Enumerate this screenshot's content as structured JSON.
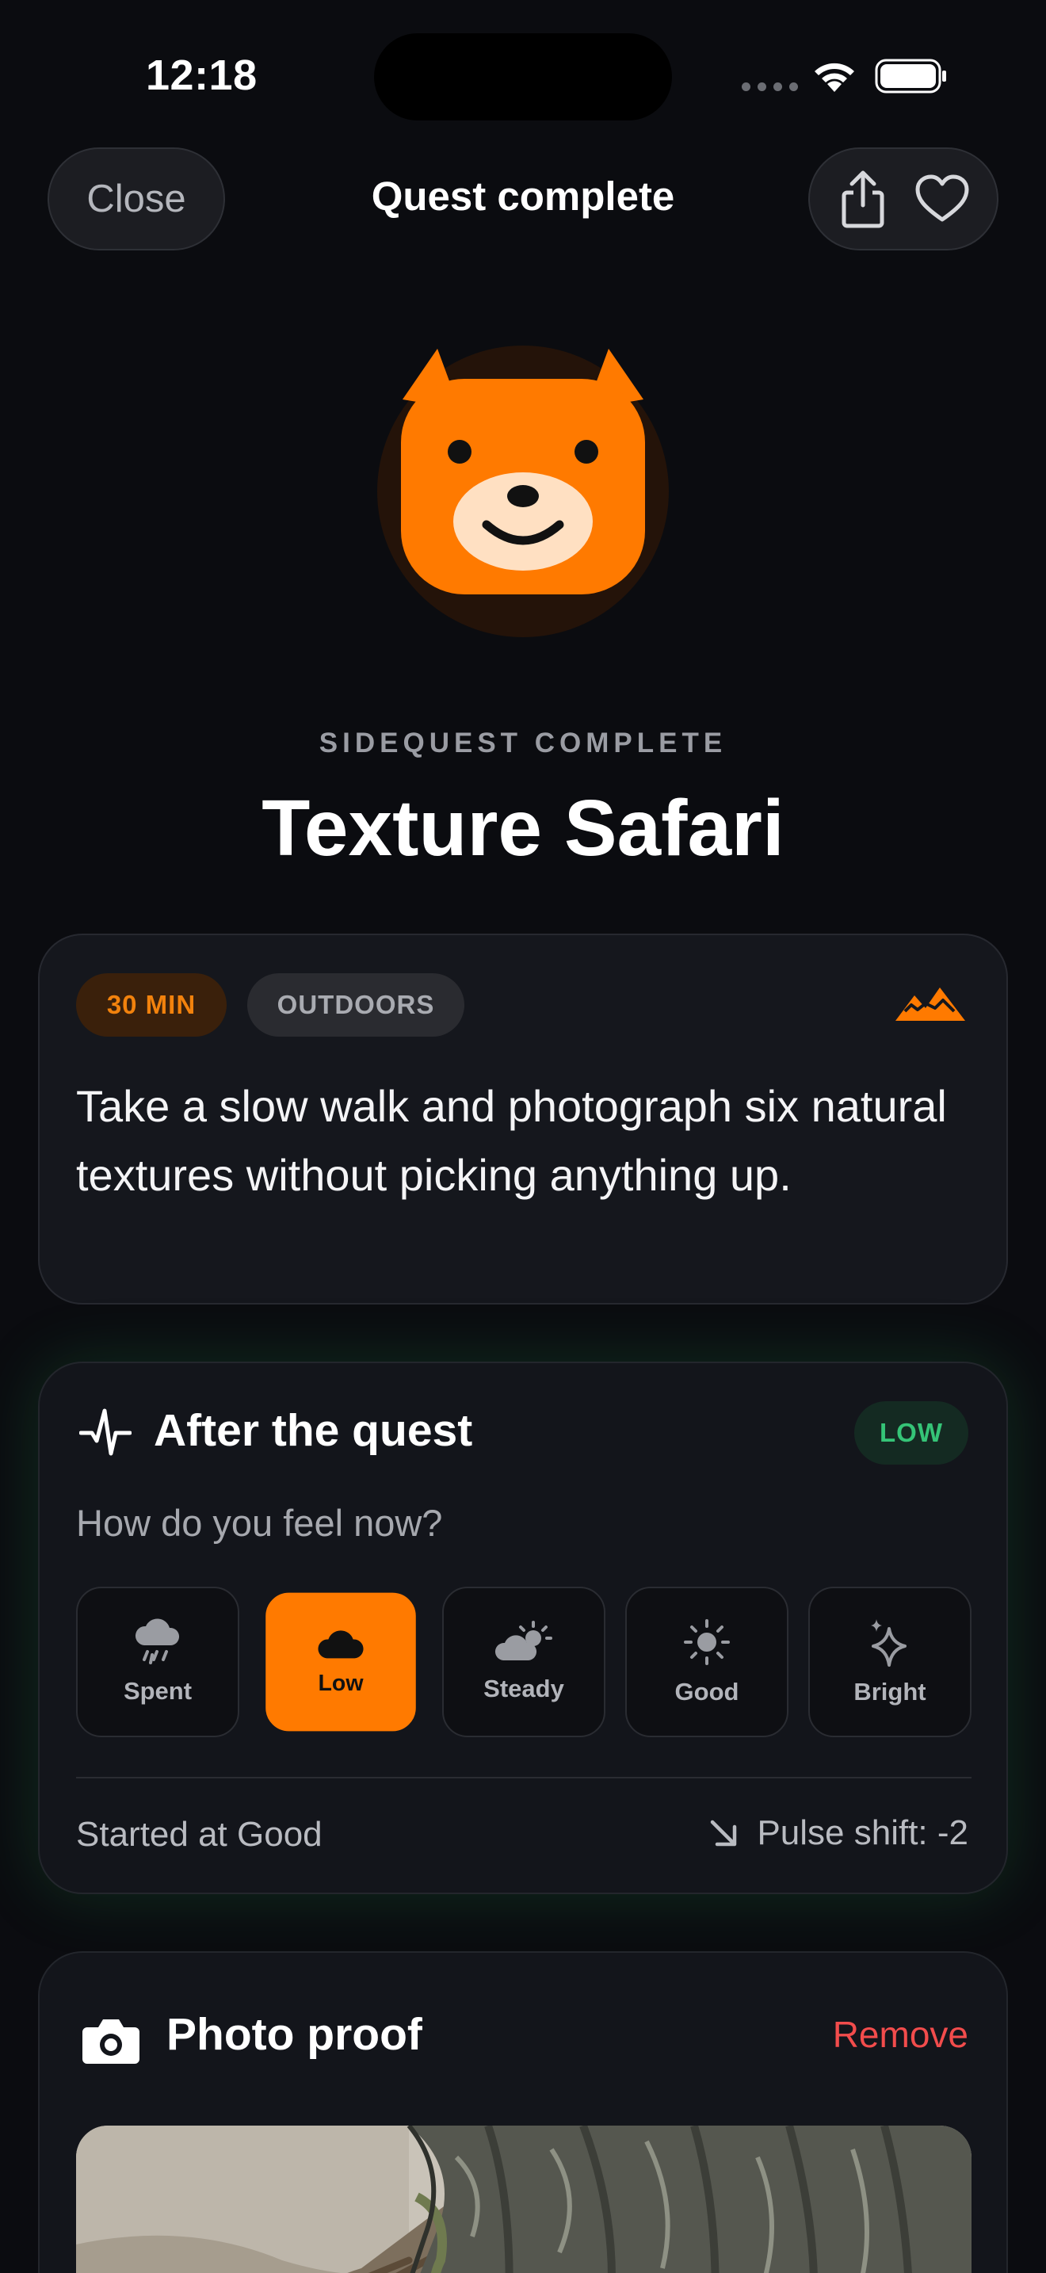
{
  "status": {
    "time": "12:18"
  },
  "nav": {
    "close_label": "Close",
    "title": "Quest complete"
  },
  "hero": {
    "eyebrow": "SIDEQUEST COMPLETE",
    "title": "Texture Safari"
  },
  "quest": {
    "duration": "30 MIN",
    "location": "OUTDOORS",
    "description": "Take a slow walk and photograph six natural textures without picking anything up."
  },
  "mood": {
    "heading": "After the quest",
    "badge": "LOW",
    "question": "How do you feel now?",
    "options": [
      {
        "label": "Spent",
        "icon": "rain-cloud-icon"
      },
      {
        "label": "Low",
        "icon": "cloud-icon",
        "selected": true
      },
      {
        "label": "Steady",
        "icon": "partly-sunny-icon"
      },
      {
        "label": "Good",
        "icon": "sun-icon"
      },
      {
        "label": "Bright",
        "icon": "sparkle-icon"
      }
    ],
    "started": "Started at Good",
    "shift": "Pulse shift: -2"
  },
  "photo": {
    "heading": "Photo proof",
    "remove_label": "Remove"
  },
  "colors": {
    "accent": "#ff7a00",
    "positive": "#35c477",
    "danger": "#f24c4c",
    "background": "#0b0c10"
  }
}
